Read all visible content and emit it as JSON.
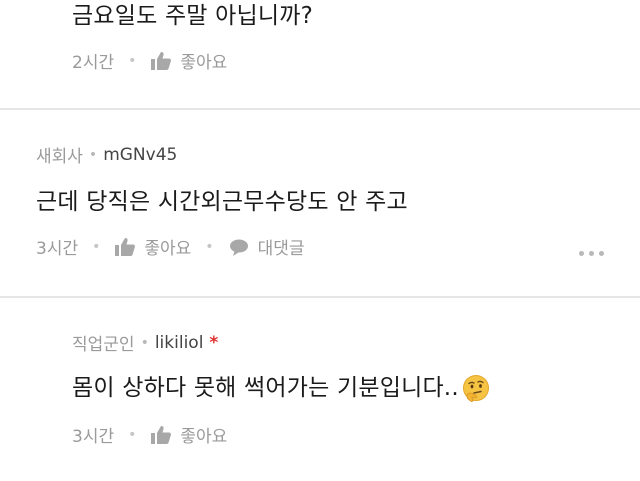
{
  "comments": [
    {
      "text": "금요일도 주말 아닙니까?",
      "time": "2시간",
      "like_label": "좋아요"
    },
    {
      "author_job": "새회사",
      "author_name": "mGNv45",
      "text": "근데 당직은 시간외근무수당도 안 주고",
      "time": "3시간",
      "like_label": "좋아요",
      "reply_label": "대댓글"
    },
    {
      "author_job": "직업군인",
      "author_name": "likiliol",
      "author_mark": "*",
      "text": "몸이 상하다 못해 썩어가는 기분입니다..",
      "emoji": "thinking-face",
      "time": "3시간",
      "like_label": "좋아요"
    }
  ],
  "colors": {
    "background": "#ffffff",
    "separator": "#e6e6e6",
    "text": "#1b1b1b",
    "meta": "#9a9a9a",
    "author_mark": "#e0322f"
  }
}
